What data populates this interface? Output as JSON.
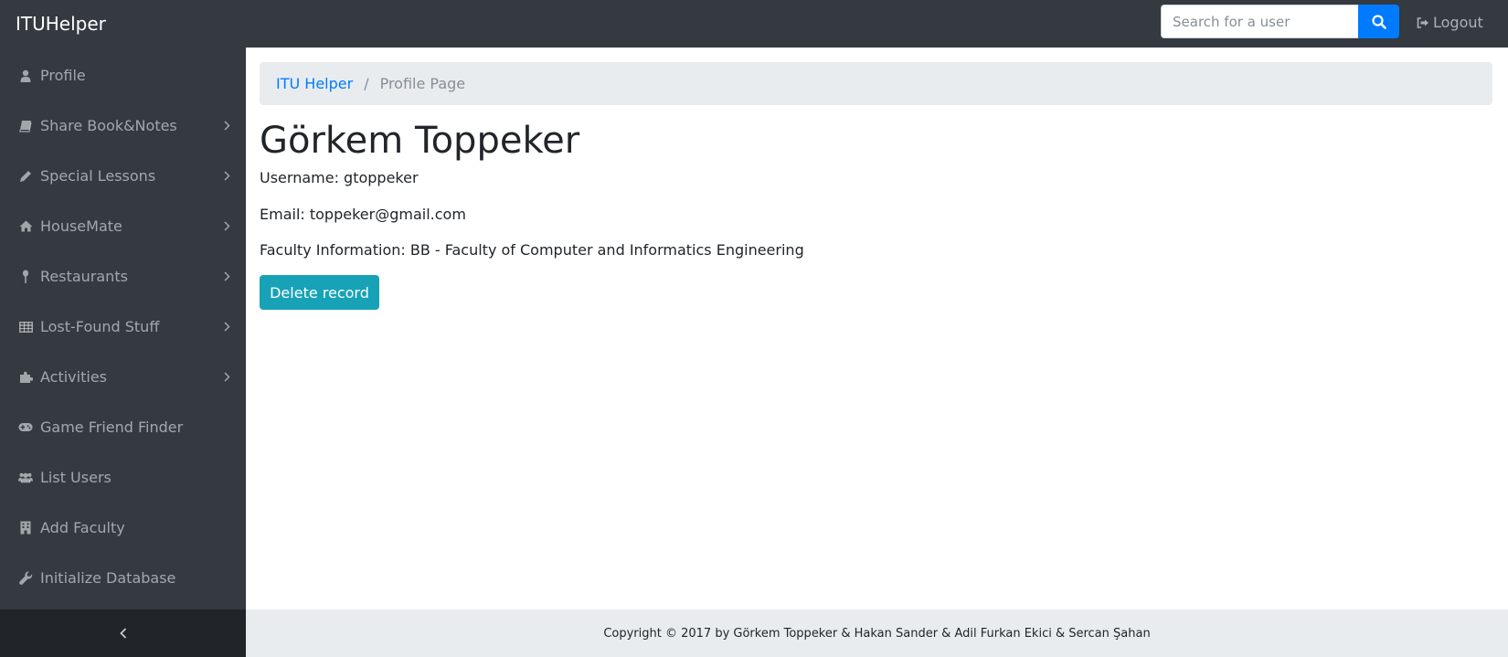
{
  "header": {
    "brand": "ITUHelper",
    "search_placeholder": "Search for a user",
    "search_icon": "search-icon",
    "logout_label": "Logout",
    "logout_icon": "sign-out-icon"
  },
  "sidebar": {
    "items": [
      {
        "label": "Profile",
        "icon": "user-icon",
        "has_submenu": false
      },
      {
        "label": "Share Book&Notes",
        "icon": "book-icon",
        "has_submenu": true
      },
      {
        "label": "Special Lessons",
        "icon": "pencil-icon",
        "has_submenu": true
      },
      {
        "label": "HouseMate",
        "icon": "home-icon",
        "has_submenu": true
      },
      {
        "label": "Restaurants",
        "icon": "thumb-tack-icon",
        "has_submenu": true
      },
      {
        "label": "Lost-Found Stuff",
        "icon": "table-icon",
        "has_submenu": true
      },
      {
        "label": "Activities",
        "icon": "puzzle-icon",
        "has_submenu": true
      },
      {
        "label": "Game Friend Finder",
        "icon": "gamepad-icon",
        "has_submenu": false
      },
      {
        "label": "List Users",
        "icon": "users-icon",
        "has_submenu": false
      },
      {
        "label": "Add Faculty",
        "icon": "building-icon",
        "has_submenu": false
      },
      {
        "label": "Initialize Database",
        "icon": "wrench-icon",
        "has_submenu": false
      }
    ],
    "collapse_icon": "chevron-left-icon"
  },
  "breadcrumb": {
    "home": "ITU Helper",
    "separator": "/",
    "current": "Profile Page"
  },
  "profile": {
    "name": "Görkem Toppeker",
    "username_line": "Username: gtoppeker",
    "email_line": "Email: toppeker@gmail.com",
    "faculty_line": "Faculty Information: BB - Faculty of Computer and Informatics Engineering",
    "delete_label": "Delete record"
  },
  "footer": {
    "copyright": "Copyright © 2017 by Görkem Toppeker & Hakan Sander & Adil Furkan Ekici & Sercan Şahan"
  },
  "colors": {
    "navbar": "#343a40",
    "primary": "#007bff",
    "info": "#17a2b8",
    "breadcrumb_bg": "#e9ecef",
    "sidebar_toggle": "#212529"
  }
}
